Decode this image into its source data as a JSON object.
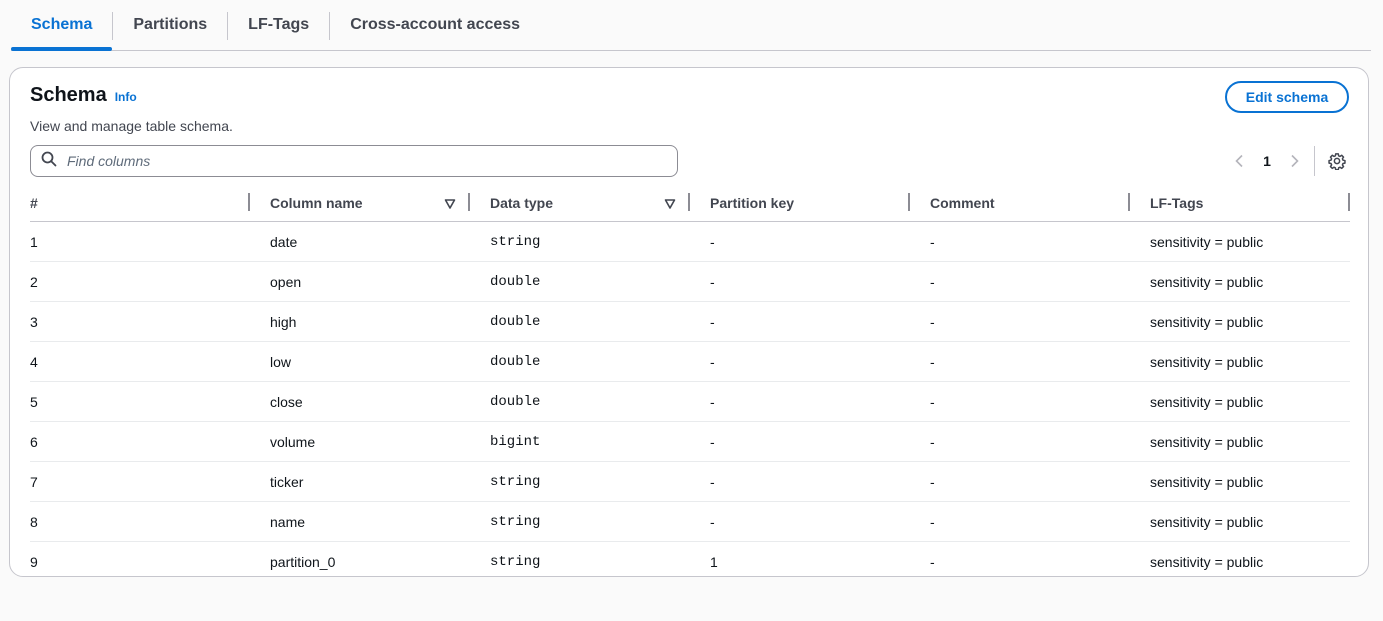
{
  "tabs": [
    {
      "label": "Schema",
      "active": true
    },
    {
      "label": "Partitions",
      "active": false
    },
    {
      "label": "LF-Tags",
      "active": false
    },
    {
      "label": "Cross-account access",
      "active": false
    }
  ],
  "panel": {
    "title": "Schema",
    "info_label": "Info",
    "description": "View and manage table schema.",
    "edit_button_label": "Edit schema"
  },
  "search": {
    "placeholder": "Find columns",
    "value": "",
    "icon": "search-icon"
  },
  "pagination": {
    "current_page": "1",
    "prev_icon": "chevron-left-icon",
    "next_icon": "chevron-right-icon",
    "settings_icon": "gear-icon"
  },
  "table": {
    "headers": [
      "#",
      "Column name",
      "Data type",
      "Partition key",
      "Comment",
      "LF-Tags"
    ],
    "rows": [
      [
        "1",
        "date",
        "string",
        "-",
        "-",
        "sensitivity = public"
      ],
      [
        "2",
        "open",
        "double",
        "-",
        "-",
        "sensitivity = public"
      ],
      [
        "3",
        "high",
        "double",
        "-",
        "-",
        "sensitivity = public"
      ],
      [
        "4",
        "low",
        "double",
        "-",
        "-",
        "sensitivity = public"
      ],
      [
        "5",
        "close",
        "double",
        "-",
        "-",
        "sensitivity = public"
      ],
      [
        "6",
        "volume",
        "bigint",
        "-",
        "-",
        "sensitivity = public"
      ],
      [
        "7",
        "ticker",
        "string",
        "-",
        "-",
        "sensitivity = public"
      ],
      [
        "8",
        "name",
        "string",
        "-",
        "-",
        "sensitivity = public"
      ],
      [
        "9",
        "partition_0",
        "string",
        "1",
        "-",
        "sensitivity = public"
      ]
    ]
  },
  "colors": {
    "accent": "#0972d3",
    "text": "#0f141a",
    "muted": "#424650",
    "border": "#c6c6cd"
  }
}
